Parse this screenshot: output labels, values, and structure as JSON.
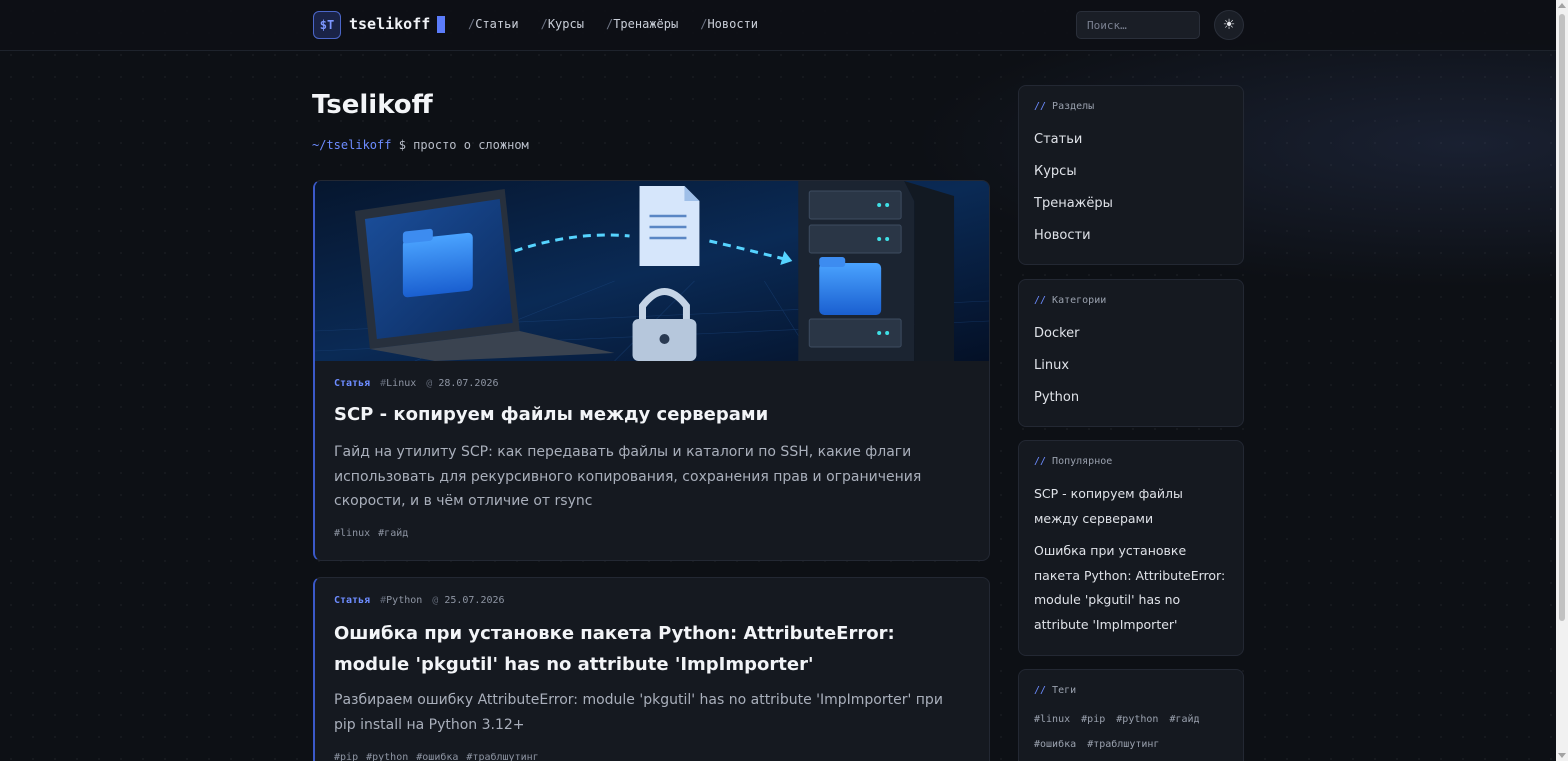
{
  "header": {
    "logo_mark": "$T",
    "logo_text": "tselikoff",
    "nav": [
      {
        "slash": "/",
        "label": "Статьи"
      },
      {
        "slash": "/",
        "label": "Курсы"
      },
      {
        "slash": "/",
        "label": "Тренажёры"
      },
      {
        "slash": "/",
        "label": "Новости"
      }
    ],
    "search_placeholder": "Поиск…",
    "theme_icon": "☀"
  },
  "main": {
    "title": "Tselikoff",
    "tagline_path": "~/tselikoff",
    "tagline_text": "$ просто о сложном",
    "articles": [
      {
        "category": "Статья",
        "topic": "Linux",
        "date": "28.07.2026",
        "title": "SCP - копируем файлы между серверами",
        "description": "Гайд на утилиту SCP: как передавать файлы и каталоги по SSH, какие флаги использовать для рекурсивного копирования, сохранения прав и ограничения скорости, и в чём отличие от rsync",
        "tags": [
          "linux",
          "гайд"
        ]
      },
      {
        "category": "Статья",
        "topic": "Python",
        "date": "25.07.2026",
        "title": "Ошибка при установке пакета Python: AttributeError: module 'pkgutil' has no attribute 'ImpImporter'",
        "description": "Разбираем ошибку AttributeError: module 'pkgutil' has no attribute 'ImpImporter' при pip install на Python 3.12+",
        "tags": [
          "pip",
          "python",
          "ошибка",
          "траблшутинг"
        ]
      }
    ]
  },
  "sidebar": {
    "sections": {
      "title": "Разделы",
      "items": [
        "Статьи",
        "Курсы",
        "Тренажёры",
        "Новости"
      ]
    },
    "categories": {
      "title": "Категории",
      "items": [
        "Docker",
        "Linux",
        "Python"
      ]
    },
    "popular": {
      "title": "Популярное",
      "items": [
        "SCP - копируем файлы между серверами",
        "Ошибка при установке пакета Python: AttributeError: module 'pkgutil' has no attribute 'ImpImporter'"
      ]
    },
    "tags": {
      "title": "Теги",
      "items": [
        "#linux",
        "#pip",
        "#python",
        "#гайд",
        "#ошибка",
        "#траблшутинг"
      ]
    }
  },
  "colors": {
    "accent": "#5b7cfa",
    "background": "#0d1015",
    "card": "#151920"
  },
  "icons": {
    "theme": "sun-icon"
  }
}
